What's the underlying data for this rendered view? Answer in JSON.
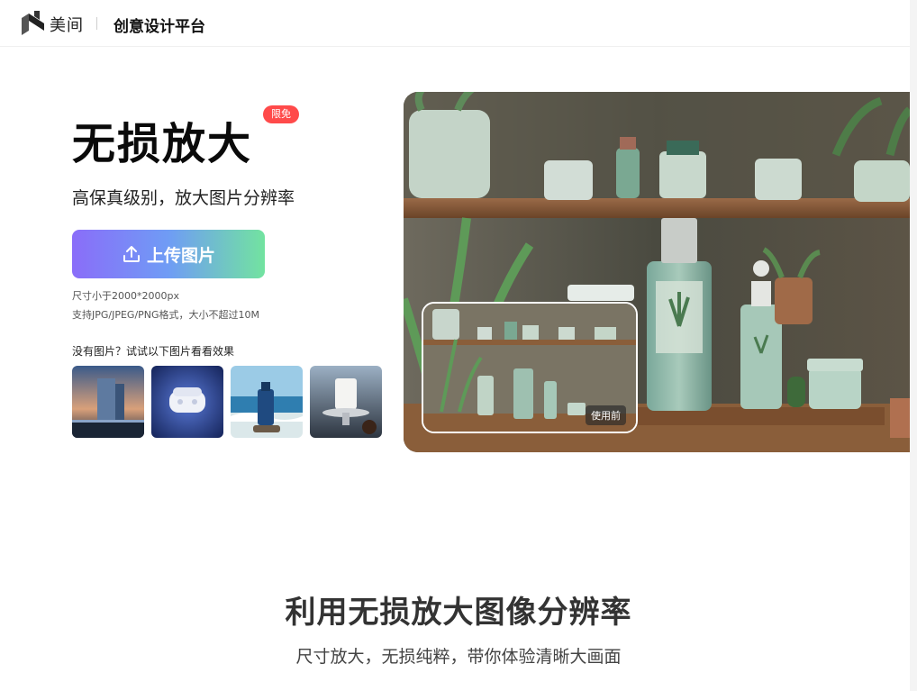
{
  "header": {
    "brand": "美间",
    "platform": "创意设计平台"
  },
  "hero": {
    "title": "无损放大",
    "badge": "限免",
    "subtitle": "高保真级别，放大图片分辨率",
    "upload_label": "上传图片",
    "hint_size": "尺寸小于2000*2000px",
    "hint_format": "支持JPG/JPEG/PNG格式，大小不超过10M",
    "sample_title": "没有图片？试试以下图片看看效果",
    "samples": [
      {
        "name": "sample-glass-building"
      },
      {
        "name": "sample-earbuds"
      },
      {
        "name": "sample-bottle-beach"
      },
      {
        "name": "sample-white-device"
      }
    ]
  },
  "showcase": {
    "before_label": "使用前"
  },
  "section": {
    "title": "利用无损放大图像分辨率",
    "subtitle": "尺寸放大，无损纯粹，带你体验清晰大画面"
  },
  "colors": {
    "badge": "#ff4a4a",
    "button_gradient": [
      "#8a6df9",
      "#6f9cf5",
      "#72e3a0"
    ]
  }
}
